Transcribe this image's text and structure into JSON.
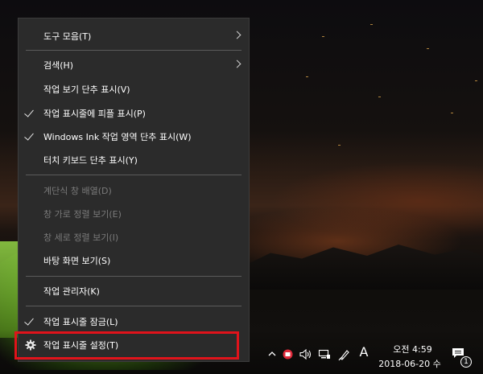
{
  "context_menu": {
    "items": [
      {
        "label": "도구 모음(T)",
        "submenu": true,
        "checked": false,
        "enabled": true
      },
      {
        "label": "검색(H)",
        "submenu": true,
        "checked": false,
        "enabled": true
      },
      {
        "label": "작업 보기 단추 표시(V)",
        "submenu": false,
        "checked": false,
        "enabled": true
      },
      {
        "label": "작업 표시줄에 피플 표시(P)",
        "submenu": false,
        "checked": true,
        "enabled": true
      },
      {
        "label": "Windows Ink 작업 영역 단추 표시(W)",
        "submenu": false,
        "checked": true,
        "enabled": true
      },
      {
        "label": "터치 키보드 단추 표시(Y)",
        "submenu": false,
        "checked": false,
        "enabled": true
      },
      {
        "label": "계단식 창 배열(D)",
        "submenu": false,
        "checked": false,
        "enabled": false
      },
      {
        "label": "창 가로 정렬 보기(E)",
        "submenu": false,
        "checked": false,
        "enabled": false
      },
      {
        "label": "창 세로 정렬 보기(I)",
        "submenu": false,
        "checked": false,
        "enabled": false
      },
      {
        "label": "바탕 화면 보기(S)",
        "submenu": false,
        "checked": false,
        "enabled": true
      },
      {
        "label": "작업 관리자(K)",
        "submenu": false,
        "checked": false,
        "enabled": true
      },
      {
        "label": "작업 표시줄 잠금(L)",
        "submenu": false,
        "checked": true,
        "enabled": true
      },
      {
        "label": "작업 표시줄 설정(T)",
        "submenu": false,
        "checked": false,
        "enabled": true,
        "icon": "gear-icon",
        "highlighted": true
      }
    ]
  },
  "taskbar": {
    "tray_icons": [
      "chevron-up-icon",
      "app-red-icon",
      "volume-icon",
      "network-icon",
      "pen-icon"
    ],
    "input_indicator": "A",
    "clock_time": "오전 4:59",
    "clock_date": "2018-06-20 수",
    "notification_icon": "action-center-icon",
    "notification_count": "1"
  },
  "colors": {
    "menu_bg": "#2b2b2b",
    "menu_text": "#ffffff",
    "disabled_text": "#7a7a7a",
    "highlight_border": "#e0131b"
  }
}
